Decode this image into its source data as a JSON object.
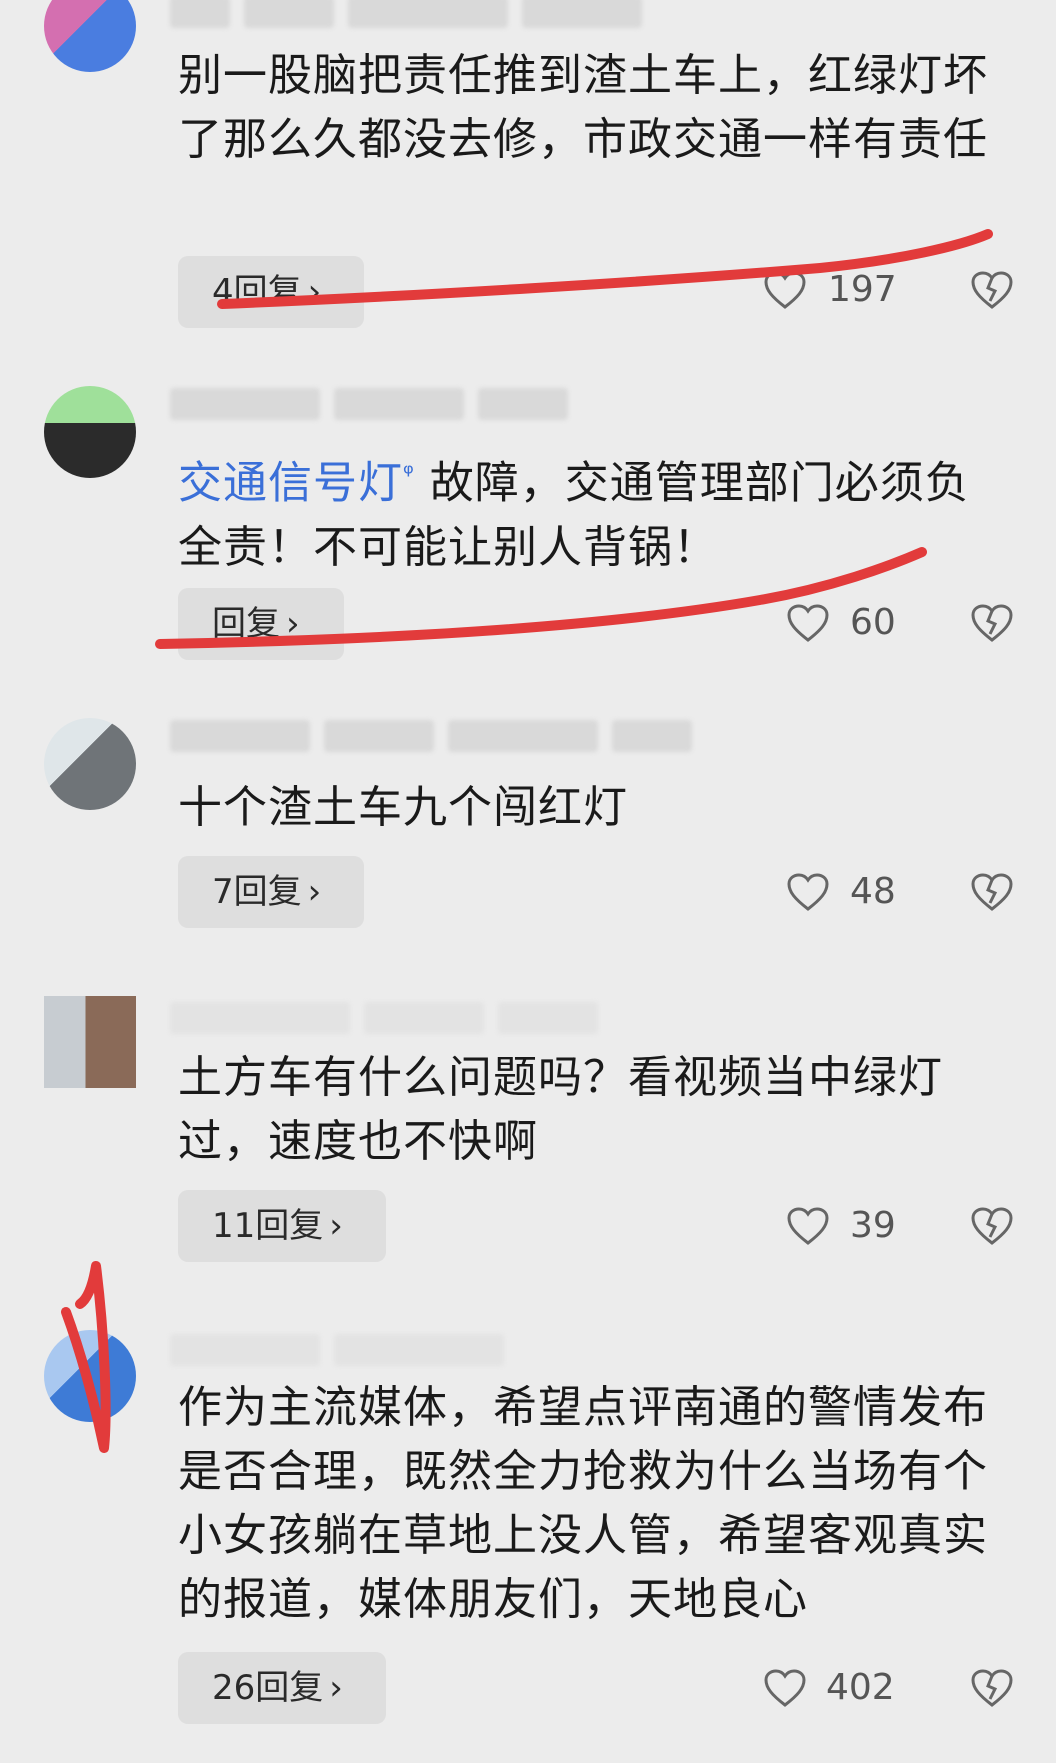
{
  "colors": {
    "background": "#ececec",
    "topic_link": "#3a6fd8",
    "annotation_red": "#e23b3b",
    "reply_bg": "#dedede"
  },
  "comments": [
    {
      "text": "别一股脑把责任推到渣土车上，红绿灯坏了那么久都没去修，市政交通一样有责任",
      "reply": "4回复",
      "likes": "197"
    },
    {
      "topic": "交通信号灯",
      "text_after": " 故障，交通管理部门必须负全责！不可能让别人背锅！",
      "reply": "回复",
      "likes": "60"
    },
    {
      "text": "十个渣土车九个闯红灯",
      "reply": "7回复",
      "likes": "48"
    },
    {
      "text": "土方车有什么问题吗？看视频当中绿灯过，速度也不快啊",
      "reply": "11回复",
      "likes": "39"
    },
    {
      "text": "作为主流媒体，希望点评南通的警情发布是否合理，既然全力抢救为什么当场有个小女孩躺在草地上没人管，希望客观真实的报道，媒体朋友们，天地良心",
      "reply": "26回复",
      "likes": "402"
    }
  ],
  "icons": {
    "like": "heart-outline-icon",
    "dislike": "broken-heart-icon",
    "chevron": "chevron-right-icon",
    "search": "search-icon"
  }
}
